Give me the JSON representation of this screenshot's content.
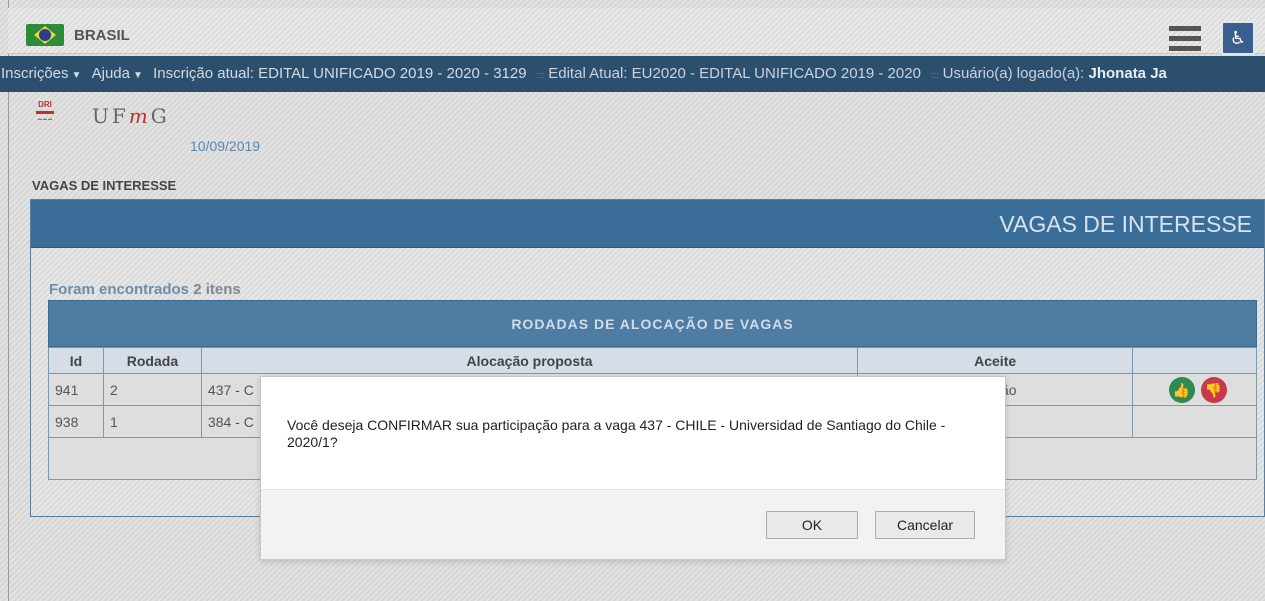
{
  "gov_bar": {
    "country": "BRASIL"
  },
  "nav": {
    "inscricoes": "Inscrições",
    "ajuda": "Ajuda",
    "inscricao_atual": "Inscrição atual: EDITAL UNIFICADO 2019 - 2020 - 3129",
    "edital_atual": "Edital Atual: EU2020 - EDITAL UNIFICADO 2019 - 2020",
    "usuario_label": "Usuário(a) logado(a):",
    "usuario_name": "Jhonata Ja"
  },
  "logo": {
    "dri": "DRI",
    "ufmg_u": "UF",
    "ufmg_m": "m",
    "ufmg_g": "G"
  },
  "date": "10/09/2019",
  "section_title": "VAGAS DE INTERESSE",
  "panel": {
    "header": "VAGAS DE INTERESSE",
    "found_bold": "Foram encontrados",
    "found_rest": "2 itens",
    "table_title": "RODADAS DE ALOCAÇÃO DE VAGAS",
    "columns": [
      "Id",
      "Rodada",
      "Alocação proposta",
      "Aceite"
    ],
    "rows": [
      {
        "id": "941",
        "rodada": "2",
        "alocacao": "437 - C",
        "aceite": "ação"
      },
      {
        "id": "938",
        "rodada": "1",
        "alocacao": "384 - C",
        "aceite": ""
      }
    ]
  },
  "dialog": {
    "message": "Você deseja CONFIRMAR sua participação para a vaga 437 - CHILE - Universidad de Santiago do Chile - 2020/1?",
    "ok": "OK",
    "cancel": "Cancelar"
  },
  "colors": {
    "nav_bg": "#2c4f6e",
    "panel_header": "#3a6d98",
    "table_title": "#4f7ca3",
    "accept_icon": "#2f8a52",
    "reject_icon": "#c8394a"
  },
  "icons": [
    "menu-icon",
    "accessibility-icon",
    "thumbs-up-icon",
    "thumbs-down-icon",
    "brazil-flag-icon"
  ]
}
